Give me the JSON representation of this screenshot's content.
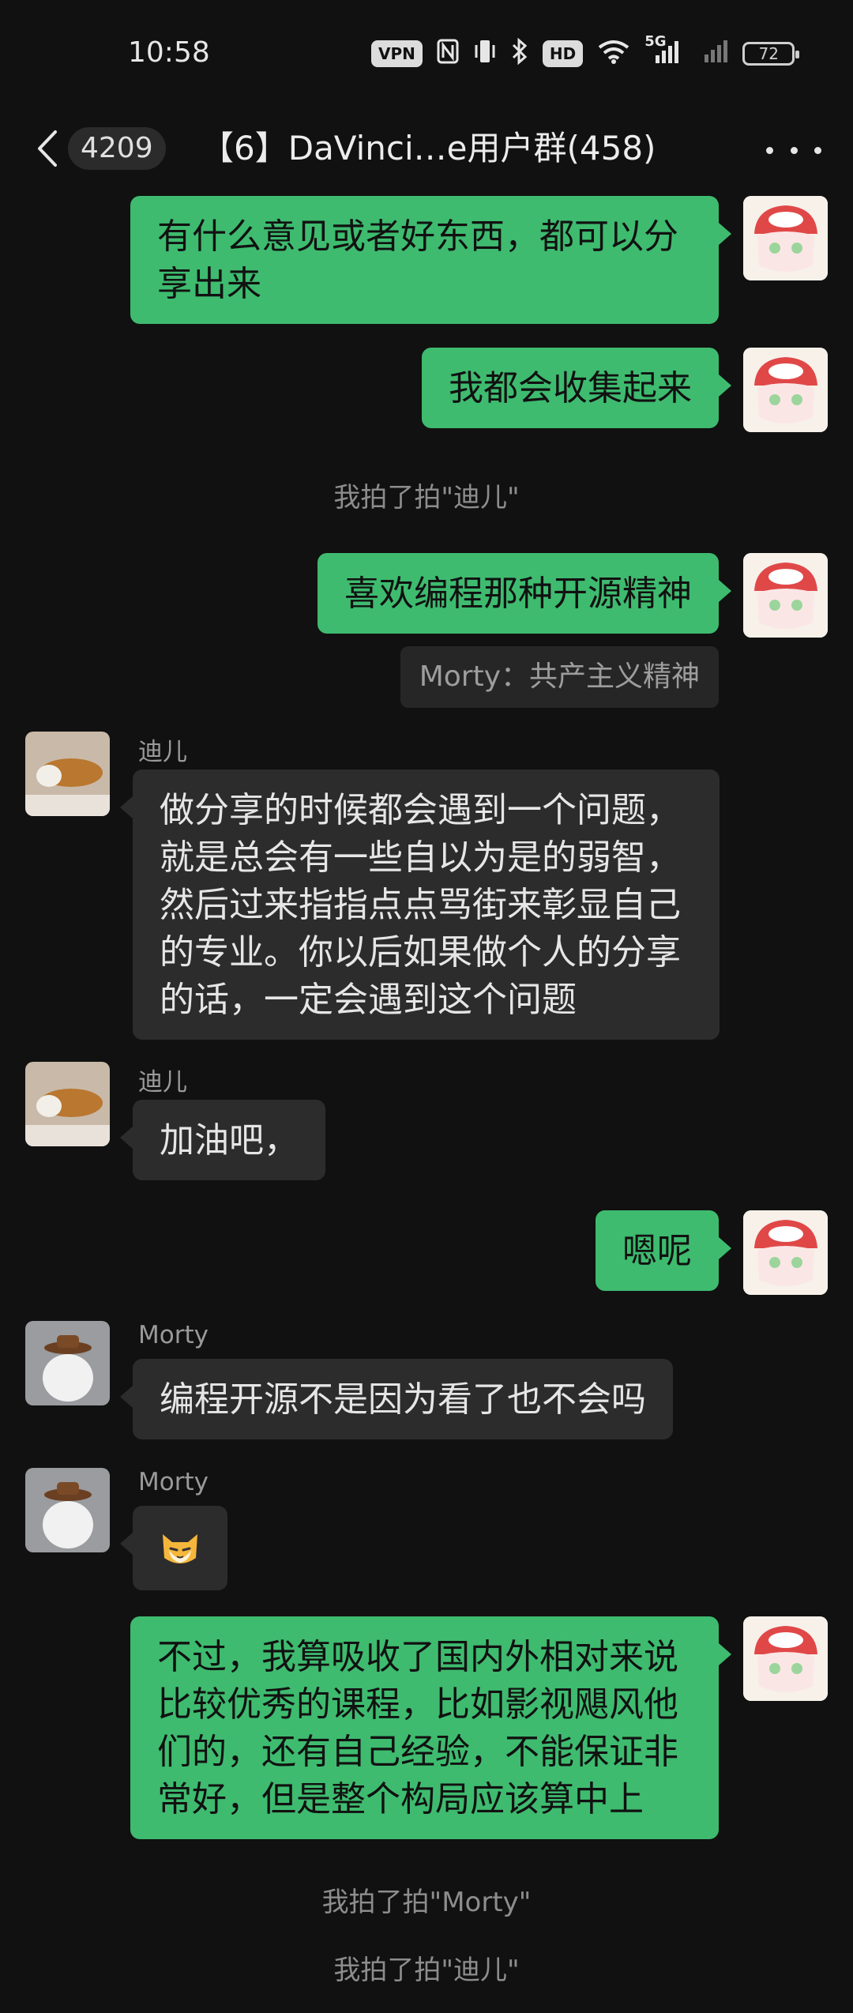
{
  "status_bar": {
    "time": "10:58",
    "vpn": "VPN",
    "hd": "HD",
    "signal": "5G",
    "battery": "72"
  },
  "header": {
    "unread_count": "4209",
    "title": "【6】DaVinci…e用户群(458)"
  },
  "messages": [
    {
      "from": "me",
      "text": "有什么意见或者好东西，都可以分享出来"
    },
    {
      "from": "me",
      "text": "我都会收集起来"
    },
    {
      "type": "system",
      "text": "我拍了拍\"迪儿\""
    },
    {
      "from": "me",
      "text": "喜欢编程那种开源精神"
    },
    {
      "type": "quote",
      "text": "Morty：共产主义精神"
    },
    {
      "from": "迪儿",
      "text": "做分享的时候都会遇到一个问题，就是总会有一些自以为是的弱智，然后过来指指点点骂街来彰显自己的专业。你以后如果做个人的分享的话，一定会遇到这个问题"
    },
    {
      "from": "迪儿",
      "text": "加油吧，"
    },
    {
      "from": "me",
      "text": "嗯呢"
    },
    {
      "from": "Morty",
      "text": "编程开源不是因为看了也不会吗"
    },
    {
      "from": "Morty",
      "sticker": "cat-emoji",
      "text": ""
    },
    {
      "from": "me",
      "text": "不过，我算吸收了国内外相对来说比较优秀的课程，比如影视飓风他们的，还有自己经验，不能保证非常好，但是整个构局应该算中上"
    },
    {
      "type": "system",
      "text": "我拍了拍\"Morty\""
    },
    {
      "type": "system",
      "text": "我拍了拍\"迪儿\""
    }
  ],
  "colors": {
    "background": "#111111",
    "self_bubble": "#3ebb6f",
    "other_bubble": "#2c2c2c"
  }
}
